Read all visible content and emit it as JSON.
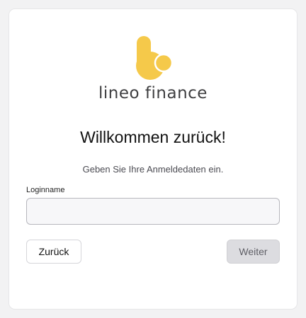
{
  "brand": {
    "name": "lineo finance",
    "logo_icon": "lineo-logo-icon",
    "accent_color": "#f5c94a"
  },
  "login": {
    "title": "Willkommen zurück!",
    "subtitle": "Geben Sie Ihre Anmeldedaten ein.",
    "field_label": "Loginname",
    "field_value": "",
    "field_placeholder": ""
  },
  "actions": {
    "back_label": "Zurück",
    "next_label": "Weiter",
    "next_disabled": true
  }
}
